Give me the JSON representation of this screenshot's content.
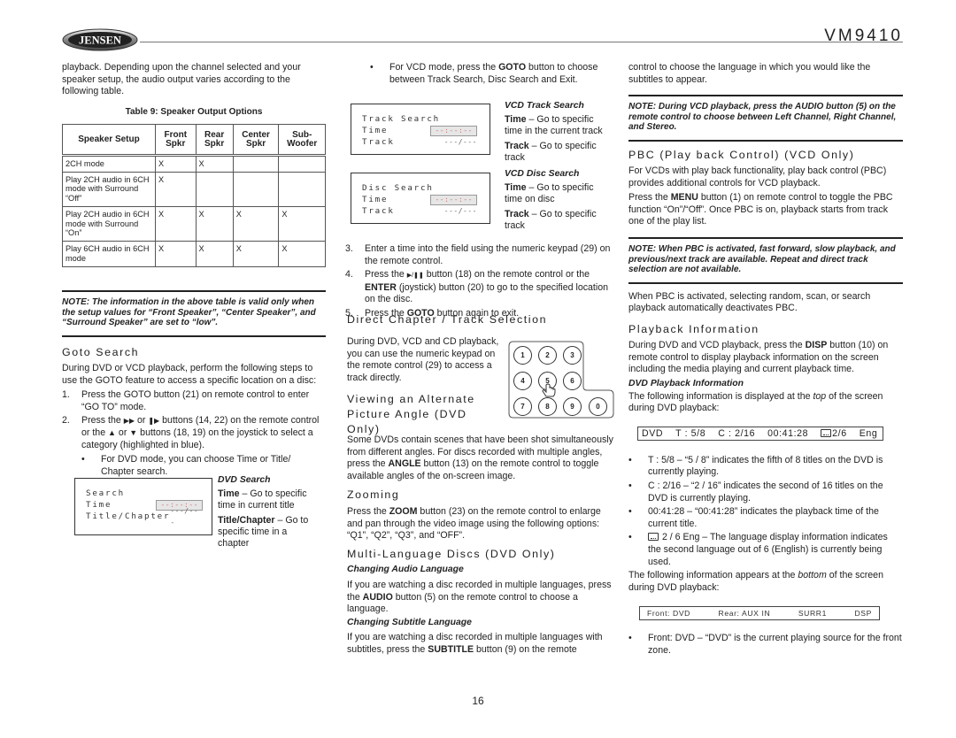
{
  "header": {
    "logo_text": "JENSEN",
    "model": "VM9410"
  },
  "col1": {
    "intro": "playback. Depending upon the channel selected and your speaker setup, the audio output varies according to the following table.",
    "table": {
      "caption": "Table 9: Speaker Output Options",
      "headers": [
        "Speaker Setup",
        "Front Spkr",
        "Rear Spkr",
        "Center Spkr",
        "Sub-Woofer"
      ],
      "rows": [
        [
          "2CH mode",
          "X",
          "X",
          "",
          ""
        ],
        [
          "Play 2CH audio in 6CH mode with Surround “Off”",
          "X",
          "",
          "",
          ""
        ],
        [
          "Play 2CH audio in 6CH mode with Surround “On”",
          "X",
          "X",
          "X",
          "X"
        ],
        [
          "Play 6CH audio in 6CH mode",
          "X",
          "X",
          "X",
          "X"
        ]
      ]
    },
    "note": "NOTE: The information in the above table is valid only when the setup values for “Front Speaker”, “Center Speaker”, and “Surround Speaker” are set to “low”.",
    "goto": {
      "heading": "Goto Search",
      "intro": "During DVD or VCD playback, perform the following steps to use the GOTO feature to access a specific location on a disc:",
      "step1_num": "1.",
      "step1": "Press the GOTO button (21) on remote control to enter “GO TO” mode.",
      "step2_num": "2.",
      "step2_a": "Press the",
      "step2_b": "or",
      "step2_c": "buttons (14, 22) on the remote control or the",
      "step2_d": "or",
      "step2_e": "buttons (18, 19) on the joystick to select a category (highlighted in blue).",
      "bullet_dvd": "For DVD mode, you can choose Time or Title/ Chapter search.",
      "bullet_mark": "•"
    },
    "dvd_search_osd": {
      "title": "Search",
      "row1_label": "Time",
      "row1_value": "--:--:--",
      "row2_label": "Title/Chapter",
      "row2_value": "---/---"
    },
    "dvd_search_desc": {
      "heading": "DVD Search",
      "time_label": "Time",
      "time_text": " – Go to specific time in current title",
      "chapter_label": "Title/Chapter",
      "chapter_text": " – Go to specific time in a chapter"
    }
  },
  "col2": {
    "bullet_vcd_pre": "For VCD mode, press the ",
    "bullet_vcd_bold": "GOTO",
    "bullet_vcd_post": " button to choose between Track Search, Disc Search and Exit.",
    "track_osd": {
      "title": "Track Search",
      "row1_label": "Time",
      "row1_value": "--:--:--",
      "row2_label": "Track",
      "row2_value": "---/---"
    },
    "disc_osd": {
      "title": "Disc Search",
      "row1_label": "Time",
      "row1_value": "--:--:--",
      "row2_label": "Track",
      "row2_value": "---/---"
    },
    "vcd_track_desc": {
      "heading": "VCD Track Search",
      "time_label": "Time",
      "time_text": " – Go to specific time in the current track",
      "track_label": "Track",
      "track_text": " – Go to specific track"
    },
    "vcd_disc_desc": {
      "heading": "VCD Disc Search",
      "time_label": "Time",
      "time_text": " – Go to specific time on disc",
      "track_label": "Track",
      "track_text": " – Go to specific track"
    },
    "step3_num": "3.",
    "step3": "Enter a time into the field using the numeric keypad (29) on the remote control.",
    "step4_num": "4.",
    "step4_a": "Press the",
    "step4_b": "button (18) on the remote control or the",
    "step4_bold": "ENTER",
    "step4_c": "(joystick) button (20) to go to the specified location on the disc.",
    "step5_num": "5.",
    "step5_a": "Press the",
    "step5_bold": "GOTO",
    "step5_b": "button again to exit.",
    "direct": {
      "heading": "Direct Chapter / Track Selection",
      "text": "During DVD, VCD and CD playback, you can use the numeric keypad on the remote control (29) to access a track directly."
    },
    "keypad_keys": [
      "1",
      "2",
      "3",
      "4",
      "5",
      "6",
      "7",
      "8",
      "9",
      "0"
    ],
    "angle": {
      "heading": "Viewing an Alternate Picture Angle (DVD Only)",
      "text_a": "Some DVDs contain scenes that have been shot simultaneously from different angles. For discs recorded with multiple angles, press the ",
      "text_bold": "ANGLE",
      "text_b": " button (13) on the remote control to toggle available angles of the on-screen image."
    },
    "zoom": {
      "heading": "Zooming",
      "text_a": "Press the ",
      "text_bold": "ZOOM",
      "text_b": " button (23) on the remote control to enlarge and pan through the video image using the following options: “Q1”, “Q2”, “Q3”, and “OFF”."
    },
    "multilang": {
      "heading": "Multi-Language Discs (DVD Only)",
      "audio_head": "Changing Audio Language",
      "audio_a": "If you are watching a disc recorded in multiple languages, press the ",
      "audio_bold": "AUDIO",
      "audio_b": " button (5) on the remote control to choose a language.",
      "sub_head": "Changing Subtitle Language",
      "sub_a": "If you are watching a disc recorded in multiple languages with subtitles, press the ",
      "sub_bold": "SUBTITLE",
      "sub_b": " button (9) on the remote"
    }
  },
  "col3": {
    "cont": "control to choose the language in which you would like the subtitles to appear.",
    "note_vcd": "NOTE: During VCD playback, press the AUDIO button (5) on the remote control to choose between Left Channel, Right Channel, and Stereo.",
    "pbc": {
      "heading": "PBC (Play back Control) (VCD Only)",
      "p1": "For VCDs with play back functionality, play back control (PBC) provides additional controls for VCD playback.",
      "p2_a": "Press the ",
      "p2_bold": "MENU",
      "p2_b": " button (1) on remote control to toggle the PBC function “On”/“Off”. Once PBC is on, playback starts from track one of the play list.",
      "note": "NOTE: When PBC is activated, fast forward, slow playback, and previous/next track are available. Repeat and direct track selection are not available.",
      "p3": "When PBC is activated, selecting random, scan, or search playback automatically deactivates PBC."
    },
    "playback_info": {
      "heading": "Playback Information",
      "p1_a": "During DVD and VCD playback, press the ",
      "p1_bold": "DISP",
      "p1_b": " button (10) on remote control to display playback information on the screen including the media playing and current playback time.",
      "sub_head": "DVD Playback Information",
      "p2_a": "The following information is displayed at the ",
      "p2_italic": "top",
      "p2_b": " of the screen during DVD playback:",
      "top_bar": {
        "source": "DVD",
        "title": "T : 5/8",
        "chapter": "C : 2/16",
        "time": "00:41:28",
        "lang": "2/6",
        "lang_name": "Eng"
      },
      "bullets": [
        "T : 5/8 – “5 / 8” indicates the fifth of 8 titles on the DVD is currently playing.",
        "C : 2/16 – “2 / 16” indicates the second of 16 titles on the DVD is currently playing.",
        "00:41:28 – “00:41:28” indicates the playback time of the current title.",
        "2 / 6 Eng – The language display information indicates the second language out of 6 (English) is currently being used."
      ],
      "bullet_mark": "•",
      "p3_a": "The following information appears at the ",
      "p3_italic": "bottom",
      "p3_b": " of the screen during DVD playback:",
      "bottom_bar": {
        "front": "Front: DVD",
        "rear": "Rear: AUX IN",
        "surr": "SURR1",
        "dsp": "DSP"
      },
      "bullet_front": "Front: DVD – “DVD” is the current playing source for the front zone."
    }
  },
  "footer": {
    "page_number": "16"
  }
}
